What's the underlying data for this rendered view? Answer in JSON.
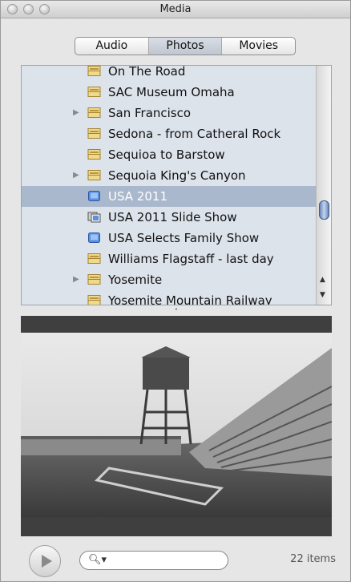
{
  "window": {
    "title": "Media"
  },
  "tabs": [
    {
      "label": "Audio",
      "active": false
    },
    {
      "label": "Photos",
      "active": true
    },
    {
      "label": "Movies",
      "active": false
    }
  ],
  "list": {
    "items": [
      {
        "label": "On The Road",
        "icon": "event-folder-icon",
        "expandable": false,
        "selected": false
      },
      {
        "label": "SAC Museum Omaha",
        "icon": "event-folder-icon",
        "expandable": false,
        "selected": false
      },
      {
        "label": "San Francisco",
        "icon": "event-folder-icon",
        "expandable": true,
        "selected": false
      },
      {
        "label": "Sedona - from Catheral Rock",
        "icon": "event-folder-icon",
        "expandable": false,
        "selected": false
      },
      {
        "label": "Sequioa to Barstow",
        "icon": "event-folder-icon",
        "expandable": false,
        "selected": false
      },
      {
        "label": "Sequoia King's Canyon",
        "icon": "event-folder-icon",
        "expandable": true,
        "selected": false
      },
      {
        "label": "USA 2011",
        "icon": "album-icon",
        "expandable": false,
        "selected": true
      },
      {
        "label": "USA 2011 Slide Show",
        "icon": "slideshow-icon",
        "expandable": false,
        "selected": false
      },
      {
        "label": "USA Selects Family Show",
        "icon": "album-icon",
        "expandable": false,
        "selected": false
      },
      {
        "label": "Williams Flagstaff - last day",
        "icon": "event-folder-icon",
        "expandable": false,
        "selected": false
      },
      {
        "label": "Yosemite",
        "icon": "event-folder-icon",
        "expandable": true,
        "selected": false
      },
      {
        "label": "Yosemite Mountain Railway",
        "icon": "event-folder-icon",
        "expandable": false,
        "selected": false
      }
    ]
  },
  "preview": {
    "alt": "photo preview"
  },
  "footer": {
    "count_label": "22 items",
    "search_icon": "magnifier-icon",
    "play_icon": "play-icon"
  }
}
